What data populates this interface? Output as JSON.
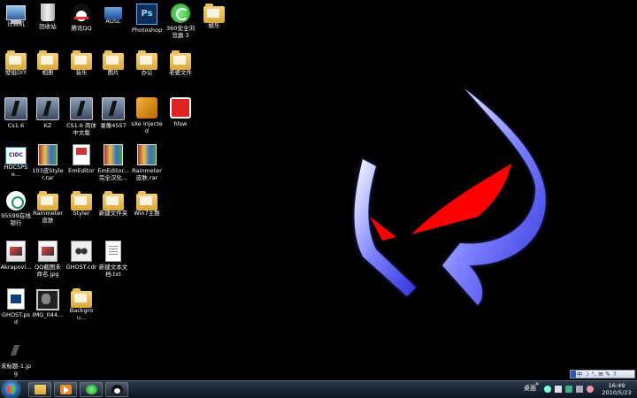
{
  "desktop": {
    "icons": [
      {
        "label": "计算机",
        "icon": "computer-icon"
      },
      {
        "label": "回收站",
        "icon": "recycle-bin-icon"
      },
      {
        "label": "腾讯QQ",
        "icon": "qq-icon"
      },
      {
        "label": "ADSL",
        "icon": "network-connection-icon"
      },
      {
        "label": "Photoshop",
        "icon": "photoshop-icon",
        "glyph_text": "Ps"
      },
      {
        "label": "360安全浏览器 3",
        "icon": "360-browser-icon"
      },
      {
        "label": "娱乐",
        "icon": "folder-icon"
      },
      {
        "label": "壁纸DIY",
        "icon": "folder-icon"
      },
      {
        "label": "相册",
        "icon": "folder-icon"
      },
      {
        "label": "音乐",
        "icon": "folder-icon"
      },
      {
        "label": "图片",
        "icon": "folder-icon"
      },
      {
        "label": "办公",
        "icon": "folder-icon"
      },
      {
        "label": "老婆文件",
        "icon": "folder-icon"
      },
      {
        "label": "Cs1.6",
        "icon": "counter-strike-icon"
      },
      {
        "label": "KZ",
        "icon": "counter-strike-icon"
      },
      {
        "label": "CS1.6 简体中文版",
        "icon": "counter-strike-icon"
      },
      {
        "label": "录像4557",
        "icon": "counter-strike-icon"
      },
      {
        "label": "sXe Injected",
        "icon": "sxe-icon"
      },
      {
        "label": "hlsw",
        "icon": "hlsw-icon"
      },
      {
        "label": "HDCSPSe...",
        "icon": "cidc-icon",
        "glyph_text": "CIDC"
      },
      {
        "label": "103皮Styler.rar",
        "icon": "winrar-icon"
      },
      {
        "label": "EmEditor",
        "icon": "emeditor-icon"
      },
      {
        "label": "EmEditor...完全汉化...",
        "icon": "winrar-icon"
      },
      {
        "label": "Rainmeter皮肤.rar",
        "icon": "winrar-icon"
      },
      {
        "label": "95599在线银行",
        "icon": "bank-icon"
      },
      {
        "label": "Rainmeter皮肤",
        "icon": "folder-icon"
      },
      {
        "label": "Styler",
        "icon": "folder-icon"
      },
      {
        "label": "新建文件夹",
        "icon": "folder-icon"
      },
      {
        "label": "Win7主题",
        "icon": "folder-icon"
      },
      {
        "label": "Akrapovi...",
        "icon": "image-file-icon"
      },
      {
        "label": "QQ截图未命名.jpg",
        "icon": "image-file-icon"
      },
      {
        "label": "GHOST.cdr",
        "icon": "ghost-cdr-icon"
      },
      {
        "label": "新建文本文档.txt",
        "icon": "text-file-icon"
      },
      {
        "label": "GHOST.psd",
        "icon": "psd-file-icon"
      },
      {
        "label": "IMG_044...",
        "icon": "photo-file-icon"
      },
      {
        "label": "Backgrou...",
        "icon": "folder-icon"
      },
      {
        "label": "未标题-1.jpg",
        "icon": "jpg-file-icon"
      }
    ]
  },
  "wallpaper": {
    "icon": "ghost-mask-wallpaper",
    "colors": {
      "blue": "#5a5cff",
      "red": "#ff0000"
    }
  },
  "langbar": {
    "items": [
      "中",
      "☽",
      "°,",
      "✉",
      "✎",
      "?"
    ]
  },
  "taskbar": {
    "start_icon": "windows-start-orb-icon",
    "pinned": [
      {
        "name": "explorer",
        "icon": "folder-icon"
      },
      {
        "name": "media-player",
        "icon": "media-player-icon"
      },
      {
        "name": "360-browser",
        "icon": "360-browser-icon"
      },
      {
        "name": "qq",
        "icon": "qq-icon"
      }
    ],
    "tray": {
      "desktop_label": "桌面",
      "chevron": "»",
      "time": "16:49",
      "date": "2010/5/23"
    }
  }
}
